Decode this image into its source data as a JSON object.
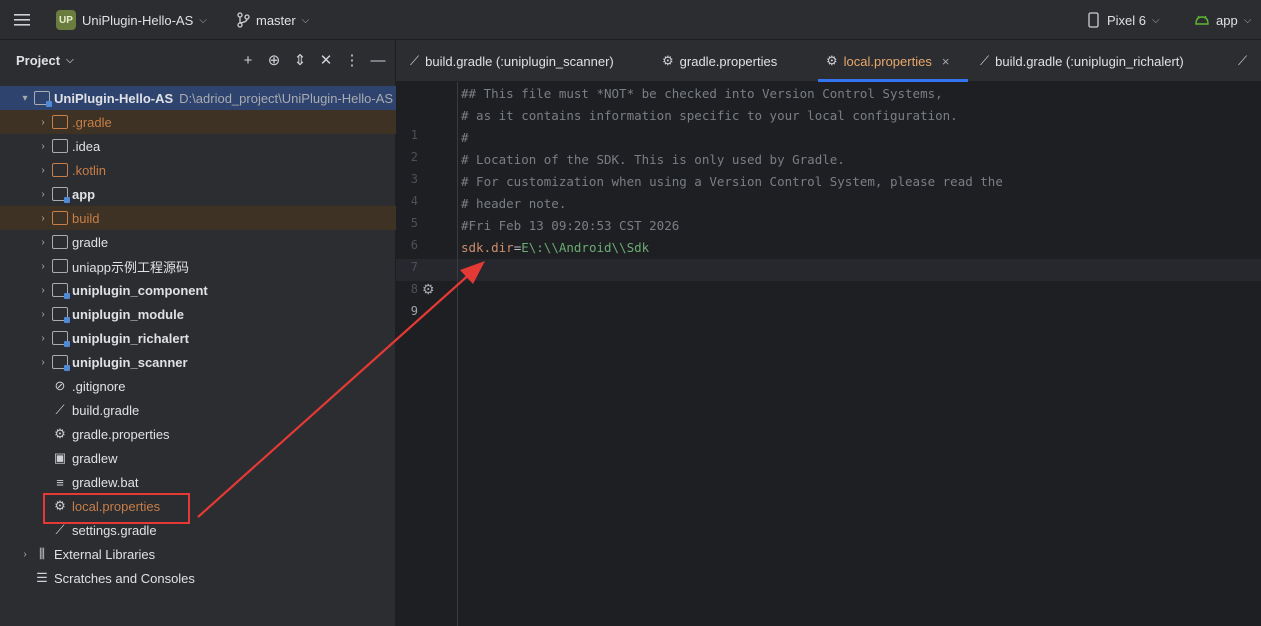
{
  "titlebar": {
    "menu_icon": "hamburger-icon",
    "project_badge": "UP",
    "project_name": "UniPlugin-Hello-AS",
    "branch": "master",
    "device": "Pixel 6",
    "run_config": "app"
  },
  "project_panel": {
    "title": "Project",
    "tools": [
      "add-icon",
      "target-icon",
      "expand-icon",
      "collapse-icon",
      "more-icon",
      "minimize-icon"
    ],
    "root": {
      "label": "UniPlugin-Hello-AS",
      "path": "D:\\adriod_project\\UniPlugin-Hello-AS"
    },
    "items": [
      {
        "label": ".gradle",
        "icon": "folder-icon"
      },
      {
        "label": ".idea",
        "icon": "folder-icon"
      },
      {
        "label": ".kotlin",
        "icon": "folder-icon"
      },
      {
        "label": "app",
        "icon": "module-folder-icon"
      },
      {
        "label": "build",
        "icon": "folder-icon"
      },
      {
        "label": "gradle",
        "icon": "folder-icon"
      },
      {
        "label": "uniapp示例工程源码",
        "icon": "folder-icon"
      },
      {
        "label": "uniplugin_component",
        "icon": "module-folder-icon"
      },
      {
        "label": "uniplugin_module",
        "icon": "module-folder-icon"
      },
      {
        "label": "uniplugin_richalert",
        "icon": "module-folder-icon"
      },
      {
        "label": "uniplugin_scanner",
        "icon": "module-folder-icon"
      },
      {
        "label": ".gitignore",
        "icon": "ignore-file-icon"
      },
      {
        "label": "build.gradle",
        "icon": "gradle-icon"
      },
      {
        "label": "gradle.properties",
        "icon": "gear-icon"
      },
      {
        "label": "gradlew",
        "icon": "terminal-icon"
      },
      {
        "label": "gradlew.bat",
        "icon": "text-file-icon"
      },
      {
        "label": "local.properties",
        "icon": "gear-icon"
      },
      {
        "label": "settings.gradle",
        "icon": "gradle-icon"
      }
    ],
    "external_libraries": "External Libraries",
    "scratches": "Scratches and Consoles"
  },
  "editor": {
    "tabs": [
      {
        "label": "build.gradle (:uniplugin_scanner)",
        "icon": "gradle-icon"
      },
      {
        "label": "gradle.properties",
        "icon": "gear-icon"
      },
      {
        "label": "local.properties",
        "icon": "gear-icon",
        "active": true
      },
      {
        "label": "build.gradle (:uniplugin_richalert)",
        "icon": "gradle-icon"
      }
    ],
    "close_glyph": "×",
    "line_numbers": [
      "1",
      "2",
      "3",
      "4",
      "5",
      "6",
      "7",
      "8",
      "9"
    ],
    "lines": [
      "## This file must *NOT* be checked into Version Control Systems,",
      "# as it contains information specific to your local configuration.",
      "#",
      "# Location of the SDK. This is only used by Gradle.",
      "# For customization when using a Version Control System, please read the",
      "# header note.",
      "#Fri Feb 13 09:20:53 CST 2026"
    ],
    "sdk_key": "sdk.dir",
    "sdk_eq": "=",
    "sdk_value": "E\\:\\\\Android\\\\Sdk"
  },
  "colors": {
    "accent": "#3574f0",
    "annotation": "#e53935",
    "orange_text": "#c77e48"
  }
}
